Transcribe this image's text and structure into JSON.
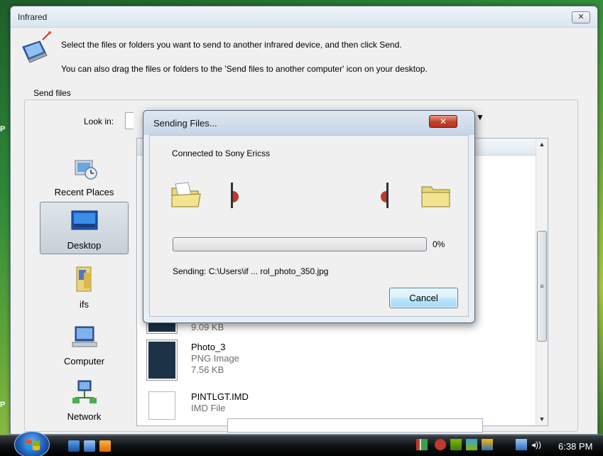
{
  "desktop": {
    "edge_glyph_1": "P",
    "edge_glyph_2": "P"
  },
  "main_window": {
    "title": "Infrared",
    "close_label": "✕",
    "instruction_line1": "Select the files or folders you want to send to another infrared device, and then click Send.",
    "instruction_line2": "You can also drag the files or folders to the 'Send files to another computer' icon on your desktop.",
    "group_label": "Send files",
    "look_in_label": "Look in:",
    "places": [
      {
        "label": "Recent Places",
        "icon": "recent-places-icon"
      },
      {
        "label": "Desktop",
        "icon": "desktop-icon",
        "selected": true
      },
      {
        "label": "ifs",
        "icon": "user-folder-icon"
      },
      {
        "label": "Computer",
        "icon": "computer-icon"
      },
      {
        "label": "Network",
        "icon": "network-icon"
      }
    ],
    "files": [
      {
        "size": "9.09 KB"
      },
      {
        "name": "Photo_3",
        "type": "PNG Image",
        "size": "7.56 KB"
      },
      {
        "name": "PINTLGT.IMD",
        "type": "IMD File"
      }
    ]
  },
  "dialog": {
    "title": "Sending Files...",
    "close_label": "✕",
    "connected_text": "Connected to Sony Ericss",
    "progress_percent_label": "0%",
    "progress_value": 0,
    "sending_text": "Sending: C:\\Users\\if ... rol_photo_350.jpg",
    "cancel_label": "Cancel"
  },
  "taskbar": {
    "clock": "6:38 PM"
  },
  "colors": {
    "dialog_close_red": "#c2402b",
    "selection_border": "#3c7fb1",
    "window_bg": "#f0f0f0"
  }
}
